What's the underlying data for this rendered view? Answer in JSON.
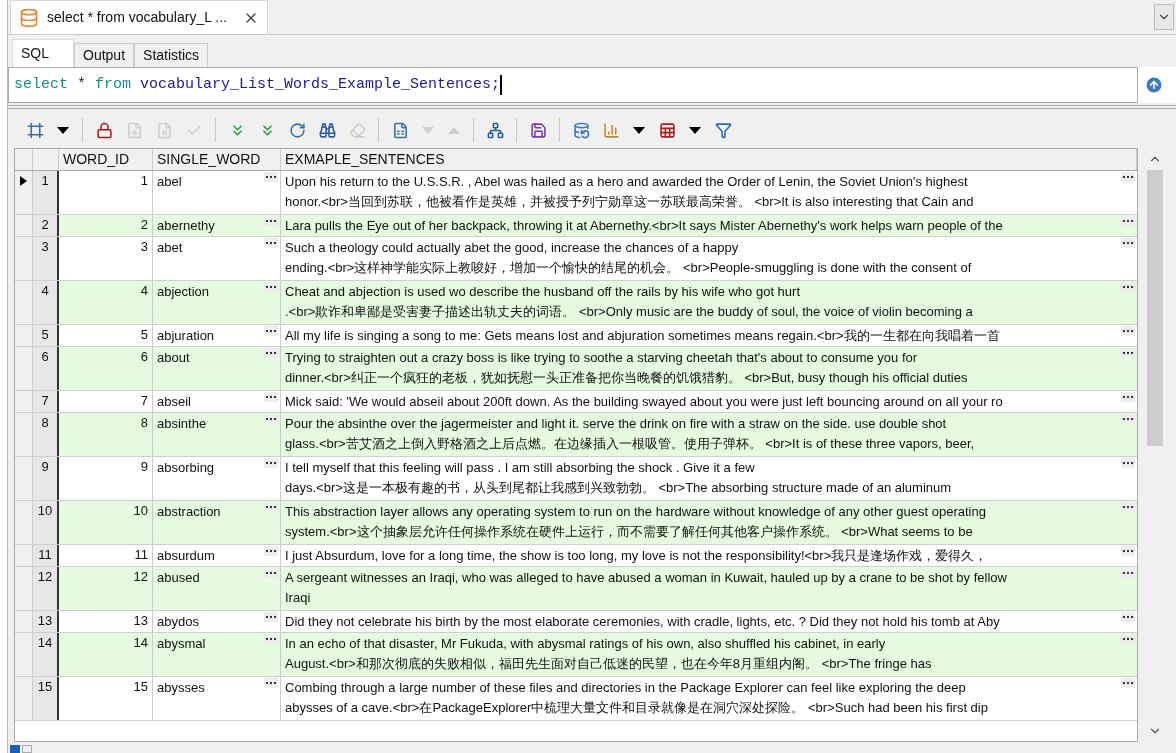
{
  "editor_tab": {
    "title": "select * from vocabulary_L ..."
  },
  "sub_tabs": [
    {
      "label": "SQL",
      "selected": true
    },
    {
      "label": "Output",
      "selected": false
    },
    {
      "label": "Statistics",
      "selected": false
    }
  ],
  "query": [
    {
      "text": "select",
      "kind": "keyword"
    },
    {
      "text": "*",
      "kind": "operator"
    },
    {
      "text": "from",
      "kind": "keyword"
    },
    {
      "text": "vocabulary_List_Words_Example_Sentences;",
      "kind": "identifier"
    }
  ],
  "toolbar": [
    {
      "kind": "grid",
      "disabled": false
    },
    {
      "kind": "dropdown",
      "disabled": false
    },
    {
      "kind": "separator"
    },
    {
      "kind": "lock",
      "disabled": false
    },
    {
      "kind": "new-row",
      "disabled": true
    },
    {
      "kind": "delete-row",
      "disabled": true
    },
    {
      "kind": "commit",
      "disabled": true
    },
    {
      "kind": "separator"
    },
    {
      "kind": "fetch-next",
      "disabled": false
    },
    {
      "kind": "fetch-all",
      "disabled": false
    },
    {
      "kind": "refresh",
      "disabled": false
    },
    {
      "kind": "find",
      "disabled": false
    },
    {
      "kind": "clear",
      "disabled": true
    },
    {
      "kind": "separator"
    },
    {
      "kind": "form",
      "disabled": false
    },
    {
      "kind": "next",
      "disabled": true
    },
    {
      "kind": "previous",
      "disabled": true
    },
    {
      "kind": "separator"
    },
    {
      "kind": "tree",
      "disabled": false
    },
    {
      "kind": "separator"
    },
    {
      "kind": "save",
      "disabled": false
    },
    {
      "kind": "separator"
    },
    {
      "kind": "export",
      "disabled": false
    },
    {
      "kind": "chart",
      "disabled": false
    },
    {
      "kind": "dropdown",
      "disabled": false
    },
    {
      "kind": "table",
      "disabled": false
    },
    {
      "kind": "dropdown",
      "disabled": false
    },
    {
      "kind": "filter",
      "disabled": false
    }
  ],
  "table": {
    "columns": [
      "WORD_ID",
      "SINGLE_WORD",
      "EXMAPLE_SENTENCES"
    ],
    "rows": [
      {
        "number": "1",
        "selected": true,
        "word_id": "1",
        "word": "abel",
        "sentences": "Upon his return to the U.S.S.R. , Abel was hailed as a hero and awarded the Order of Lenin, the Soviet Union's highest\nhonor.<br>当回到苏联，他被看作是英雄，并被授予列宁勋章这一苏联最高荣誉。 <br>It is also interesting that Cain and"
      },
      {
        "number": "2",
        "selected": false,
        "word_id": "2",
        "word": "abernethy",
        "sentences": "Lara pulls the Eye out of her backpack, throwing it at Abernethy.<br>It says Mister Abernethy's work helps warn people of the"
      },
      {
        "number": "3",
        "selected": false,
        "word_id": "3",
        "word": "abet",
        "sentences": "Such a theology could actually abet the good, increase the chances of a happy\nending.<br>这样神学能实际上教唆好，增加一个愉快的结尾的机会。 <br>People-smuggling is done with the consent of"
      },
      {
        "number": "4",
        "selected": false,
        "word_id": "4",
        "word": "abjection",
        "sentences": "Cheat and abjection is used wo describe the husband off the rails by his wife who got hurt\n.<br>欺诈和卑鄙是受害妻子描述出轨丈夫的词语。 <br>Only music are the buddy of soul, the voice of violin becoming a"
      },
      {
        "number": "5",
        "selected": false,
        "word_id": "5",
        "word": "abjuration",
        "sentences": "All my life is singing a song to me: Gets means lost and abjuration sometimes means regain.<br>我的一生都在向我唱着一首"
      },
      {
        "number": "6",
        "selected": false,
        "word_id": "6",
        "word": "about",
        "sentences": "Trying to straighten out a crazy boss is like trying to soothe a starving cheetah that's about to consume you for\ndinner.<br>纠正一个疯狂的老板，犹如抚慰一头正准备把你当晚餐的饥饿猎豹。 <br>But, busy though his official duties"
      },
      {
        "number": "7",
        "selected": false,
        "word_id": "7",
        "word": "abseil",
        "sentences": "Mick said: 'We would abseil about 200ft down. As the building swayed about you were just left bouncing around on all your ro"
      },
      {
        "number": "8",
        "selected": false,
        "word_id": "8",
        "word": "absinthe",
        "sentences": "Pour the absinthe over the jagermeister and light it. serve the drink on fire with a straw on the side. use double shot\nglass.<br>苦艾酒之上倒入野格酒之上后点燃。在边缘插入一根吸管。使用子弹杯。 <br>It is of these three vapors, beer,"
      },
      {
        "number": "9",
        "selected": false,
        "word_id": "9",
        "word": "absorbing",
        "sentences": "I tell myself that this feeling will pass . I am still absorbing the shock . Give it a few\ndays.<br>这是一本极有趣的书，从头到尾都让我感到兴致勃勃。 <br>The absorbing structure made of an aluminum"
      },
      {
        "number": "10",
        "selected": false,
        "word_id": "10",
        "word": "abstraction",
        "sentences": "This abstraction layer allows any operating system to run on the hardware without knowledge of any other guest operating\nsystem.<br>这个抽象层允许任何操作系统在硬件上运行，而不需要了解任何其他客户操作系统。 <br>What seems to be"
      },
      {
        "number": "11",
        "selected": false,
        "word_id": "11",
        "word": "absurdum",
        "sentences": "I just Absurdum, love for a long time, the show is too long, my love is not the responsibility!<br>我只是逢场作戏，爱得久，"
      },
      {
        "number": "12",
        "selected": false,
        "word_id": "12",
        "word": "abused",
        "sentences": "A sergeant witnesses an Iraqi, who was alleged to have abused a woman in Kuwait, hauled up by a crane to be shot by fellow\nIraqi"
      },
      {
        "number": "13",
        "selected": false,
        "word_id": "13",
        "word": "abydos",
        "sentences": "Did they not celebrate his birth by the most elaborate ceremonies, with cradle, lights, etc. ? Did they not hold his tomb at Aby"
      },
      {
        "number": "14",
        "selected": false,
        "word_id": "14",
        "word": "abysmal",
        "sentences": "In an echo of that disaster, Mr Fukuda, with abysmal ratings of his own, also shuffled his cabinet, in early\nAugust.<br>和那次彻底的失败相似，福田先生面对自己低迷的民望，也在今年8月重组内阁。 <br>The fringe has"
      },
      {
        "number": "15",
        "selected": false,
        "word_id": "15",
        "word": "abysses",
        "sentences": "Combing through a large number of these files and directories in the Package Explorer can feel like exploring the deep\nabysses of a cave.<br>在PackageExplorer中梳理大量文件和目录就像是在洞穴深处探险。 <br>Such had been his first dip"
      }
    ]
  }
}
